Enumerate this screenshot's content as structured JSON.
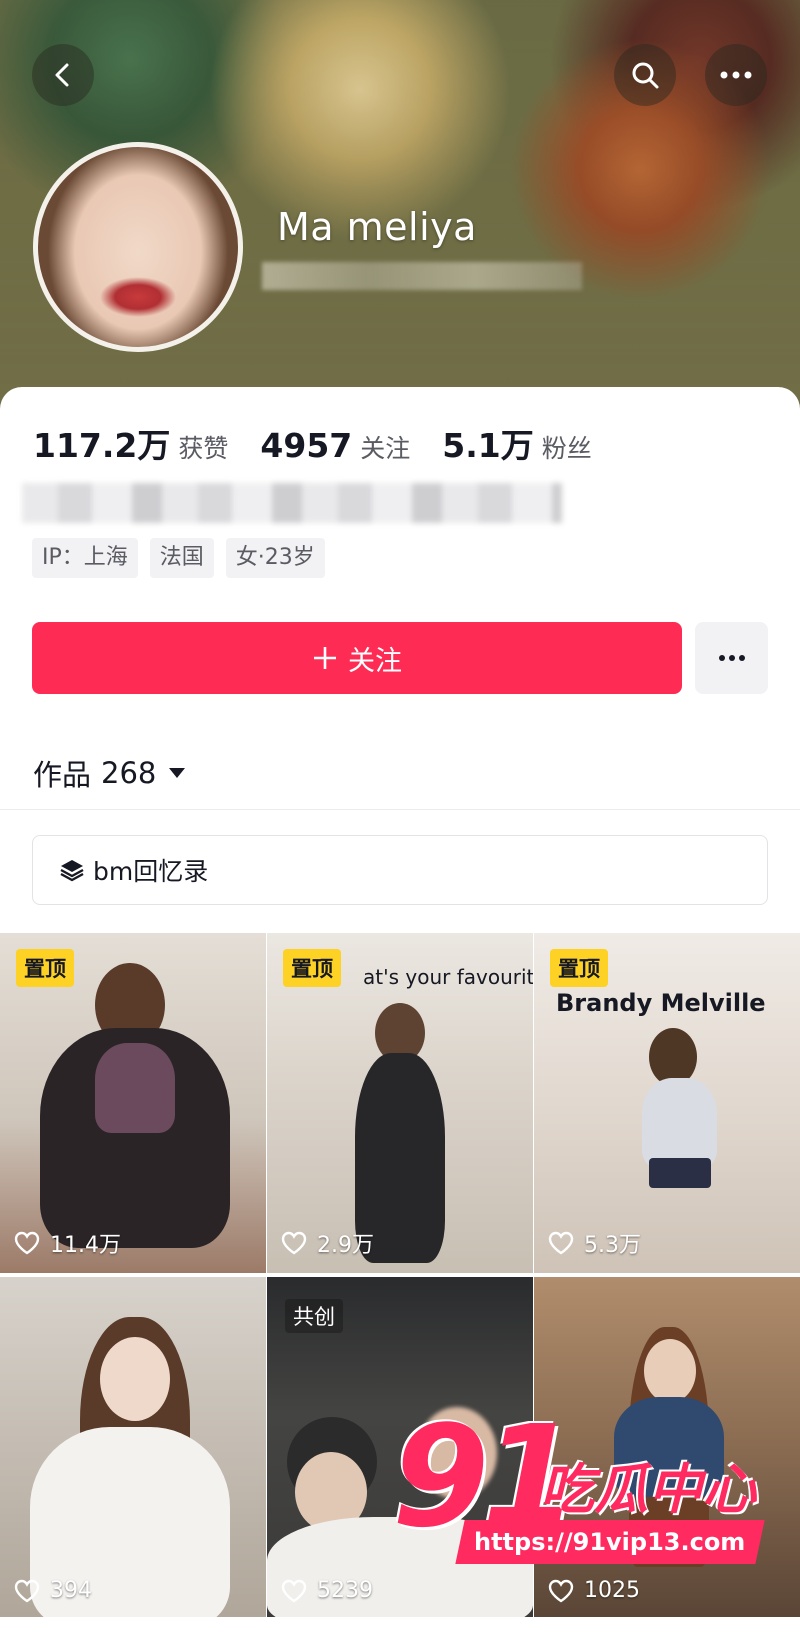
{
  "header": {
    "username": "Ma meliya"
  },
  "stats": [
    {
      "value": "117.2万",
      "label": "获赞"
    },
    {
      "value": "4957",
      "label": "关注"
    },
    {
      "value": "5.1万",
      "label": "粉丝"
    }
  ],
  "tags": [
    "IP：上海",
    "法国",
    "女·23岁"
  ],
  "actions": {
    "follow_label": "关注"
  },
  "works": {
    "label": "作品",
    "count": "268"
  },
  "collection": {
    "label": "bm回忆录"
  },
  "posts": [
    {
      "badge": "置顶",
      "likes": "11.4万"
    },
    {
      "badge": "置顶",
      "likes": "2.9万",
      "overlay": "at's your favourite?"
    },
    {
      "badge": "置顶",
      "likes": "5.3万",
      "overlay": "Brandy Melville"
    },
    {
      "likes": "394"
    },
    {
      "tag": "共创",
      "likes": "5239"
    },
    {
      "likes": "1025"
    }
  ],
  "watermark": {
    "number": "91",
    "text": "吃瓜中心",
    "url": "https://91vip13.com"
  },
  "colors": {
    "accent": "#fe2c55",
    "pin_badge": "#fdd224"
  }
}
